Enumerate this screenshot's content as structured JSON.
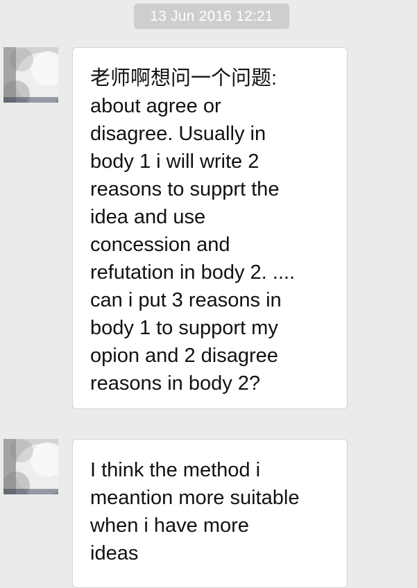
{
  "chat": {
    "timestamp": "13 Jun 2016 12:21",
    "messages": [
      {
        "text": "老师啊想问一个问题:\nabout agree or\ndisagree. Usually in\nbody 1 i will write 2\nreasons to supprt the\nidea and use\nconcession and\nrefutation in body 2. ....\ncan i put 3 reasons in\nbody 1 to support my\nopion and 2 disagree\nreasons in body 2?"
      },
      {
        "text": "I think the method i\nmeantion more suitable\nwhen i have more\nideas"
      }
    ]
  },
  "colors": {
    "background": "#ebebeb",
    "timestamp_bg": "#cecece",
    "bubble_bg": "#ffffff",
    "bubble_border": "#d2d2d2",
    "text": "#111111"
  },
  "icons": {
    "avatar": "blurred-avatar-image"
  }
}
